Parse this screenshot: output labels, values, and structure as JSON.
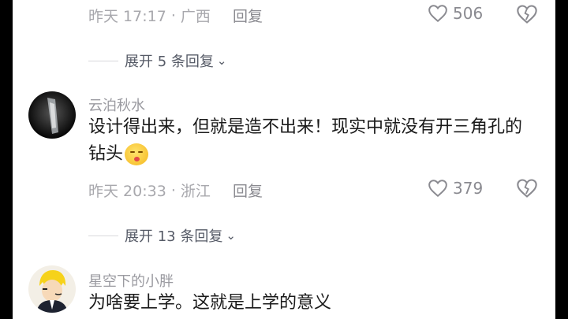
{
  "comments": [
    {
      "time": "昨天 17:17",
      "location": "广西",
      "reply_label": "回复",
      "likes": "506",
      "expand_label": "展开 5 条回复"
    },
    {
      "username": "云泊秋水",
      "content": "设计得出来，但就是造不出来！现实中就没有开三角孔的钻头",
      "emoji_icon": "embarrassed-emoji",
      "time": "昨天 20:33",
      "location": "浙江",
      "reply_label": "回复",
      "likes": "379",
      "expand_label": "展开 13 条回复"
    },
    {
      "username": "星空下的小胖",
      "content": "为啥要上学。这就是上学的意义"
    }
  ],
  "icons": {
    "like": "heart-outline-icon",
    "dislike": "broken-heart-icon",
    "expand": "chevron-down-icon"
  },
  "colors": {
    "meta_text": "#a8a8ad",
    "content_text": "#1a1a1a",
    "background": "#ffffff"
  }
}
